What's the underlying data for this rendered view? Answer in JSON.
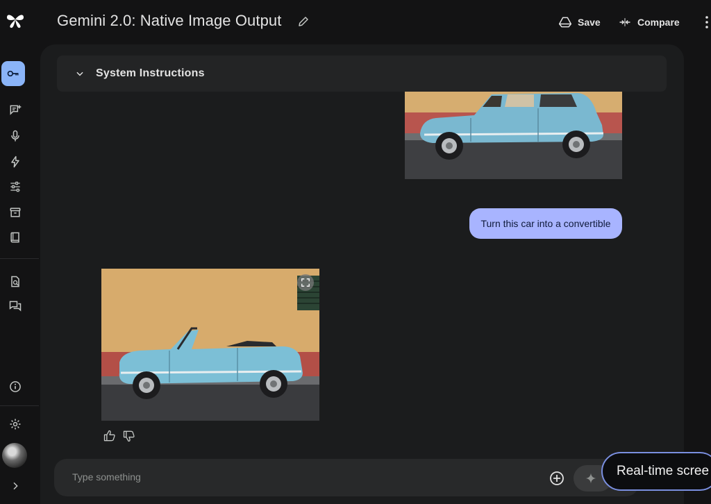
{
  "header": {
    "title": "Gemini 2.0: Native Image Output",
    "save_label": "Save",
    "compare_label": "Compare"
  },
  "system_instructions": {
    "label": "System Instructions"
  },
  "chat": {
    "user_message": "Turn this car into a convertible"
  },
  "input": {
    "placeholder": "Type something"
  },
  "tooltip": {
    "text": "Real-time scree"
  },
  "colors": {
    "background": "#131314",
    "panel": "#1b1c1d",
    "accent": "#8ab4f8",
    "bubble": "#a8b4ff"
  },
  "icons": {
    "rail": [
      "app-logo",
      "key-icon",
      "chat-add-icon",
      "mic-icon",
      "bolt-icon",
      "tune-icon",
      "archive-icon",
      "book-icon",
      "doc-search-icon",
      "forum-icon",
      "info-icon",
      "gear-icon",
      "avatar",
      "chevron-right-icon"
    ]
  }
}
